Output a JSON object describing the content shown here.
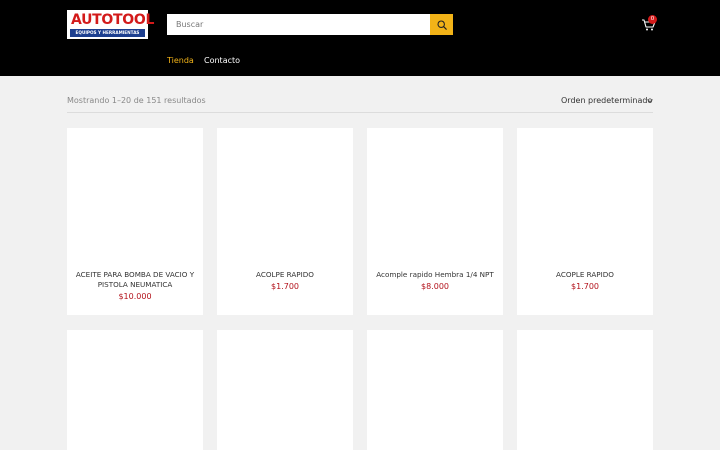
{
  "header": {
    "logo": {
      "main": "AUTOTOOL",
      "sub": "EQUIPOS Y HERRAMIENTAS"
    },
    "search": {
      "placeholder": "Buscar",
      "value": ""
    },
    "cart": {
      "count": "0"
    },
    "nav": [
      {
        "label": "Tienda",
        "active": true
      },
      {
        "label": "Contacto",
        "active": false
      }
    ]
  },
  "toolbar": {
    "results_text": "Mostrando 1–20 de 151 resultados",
    "sort_label": "Orden predeterminado"
  },
  "products": [
    {
      "title_line1": "ACEITE PARA BOMBA DE VACIO Y",
      "title_line2": "PISTOLA NEUMATICA",
      "price": "$10.000"
    },
    {
      "title_line1": "ACOLPE RAPIDO",
      "title_line2": "",
      "price": "$1.700"
    },
    {
      "title_line1": "Acomple rapido Hembra 1/4 NPT",
      "title_line2": "",
      "price": "$8.000"
    },
    {
      "title_line1": "ACOPLE RAPIDO",
      "title_line2": "",
      "price": "$1.700"
    }
  ],
  "colors": {
    "header_bg": "#000000",
    "accent": "#f2b318",
    "price": "#b3121b",
    "logo_red": "#d31a1a",
    "logo_blue": "#1d3f8f"
  }
}
